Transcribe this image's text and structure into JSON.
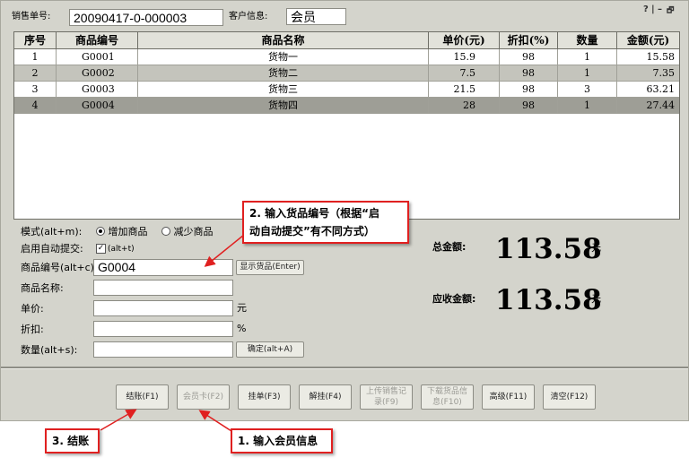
{
  "header": {
    "order_label": "销售单号:",
    "order_value": "20090417-0-000003",
    "customer_label": "客户信息:",
    "customer_value": "会员",
    "window_controls": [
      "?",
      "|",
      "–",
      "🗗"
    ]
  },
  "table": {
    "columns": [
      "序号",
      "商品编号",
      "商品名称",
      "单价(元)",
      "折扣(%)",
      "数量",
      "金额(元)"
    ],
    "rows": [
      [
        "1",
        "G0001",
        "货物一",
        "15.9",
        "98",
        "1",
        "15.58"
      ],
      [
        "2",
        "G0002",
        "货物二",
        "7.5",
        "98",
        "1",
        "7.35"
      ],
      [
        "3",
        "G0003",
        "货物三",
        "21.5",
        "98",
        "3",
        "63.21"
      ],
      [
        "4",
        "G0004",
        "货物四",
        "28",
        "98",
        "1",
        "27.44"
      ]
    ]
  },
  "form": {
    "mode_label": "模式(alt+m):",
    "mode_add": "增加商品",
    "mode_reduce": "减少商品",
    "auto_submit_label": "启用自动提交:",
    "auto_submit_hint": "(alt+t)",
    "product_code_label": "商品编号(alt+c):",
    "product_code_value": "G0004",
    "show_product_button": "显示货品(Enter)",
    "product_name_label": "商品名称:",
    "unit_price_label": "单价:",
    "unit_price_unit": "元",
    "discount_label": "折扣:",
    "discount_unit": "%",
    "quantity_label": "数量(alt+s):",
    "confirm_button": "确定(alt+A)"
  },
  "totals": {
    "total_label": "总金额:",
    "total_value": "113.58",
    "total_unit": "元",
    "receivable_label": "应收金额:",
    "receivable_value": "113.58",
    "receivable_unit": "元"
  },
  "buttons": {
    "checkout": "结账(F1)",
    "member_card": "会员卡(F2)",
    "hold": "挂单(F3)",
    "unhold": "解挂(F4)",
    "upload_line1": "上传销售记",
    "upload_line2": "录(F9)",
    "download_line1": "下载货品信",
    "download_line2": "息(F10)",
    "advanced": "高级(F11)",
    "clear": "清空(F12)"
  },
  "callouts": {
    "input_code_line1": "2. 输入货品编号（根据“启",
    "input_code_line2": "动自动提交”有不同方式）",
    "checkout_note": "3. 结账",
    "member_note": "1. 输入会员信息"
  },
  "colors": {
    "window_bg": "#d4d4cc",
    "callout_border": "#e02020",
    "selected_row": "#9e9e96"
  }
}
